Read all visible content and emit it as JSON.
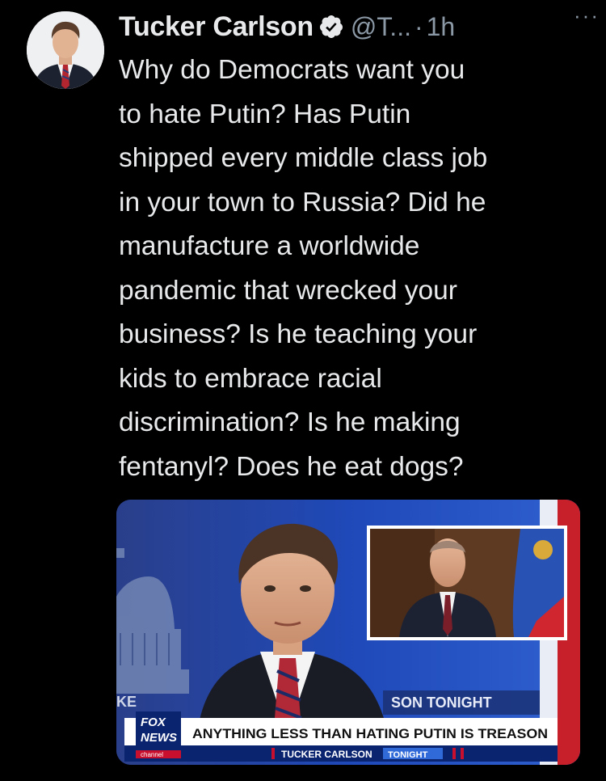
{
  "tweet": {
    "author_name": "Tucker Carlson",
    "handle": "@T...",
    "separator": "·",
    "time": "1h",
    "more_label": "···",
    "text_lines": [
      "Why do Democrats want you",
      "to hate Putin? Has Putin",
      "shipped every middle class job",
      "in your town to Russia? Did he",
      "manufacture a worldwide",
      "pandemic that wrecked your",
      "business? Is he teaching your",
      "kids to embrace racial",
      "discrimination? Is he making",
      "fentanyl? Does he eat dogs?"
    ]
  },
  "media": {
    "logo_line1": "FOX",
    "logo_line2": "NEWS",
    "logo_line3": "channel",
    "headline": "ANYTHING LESS THAN HATING PUTIN IS TREASON",
    "show_name": "TUCKER CARLSON",
    "show_tag": "TONIGHT",
    "bg_sign_text": "SON TONIGHT",
    "bg_left_text": "KE"
  },
  "colors": {
    "background": "#000000",
    "text": "#e7e9ea",
    "secondary": "#8b98a5",
    "verified": "#e7e9ea",
    "fox_red": "#c8102e",
    "studio_blue": "#1f49b8"
  }
}
